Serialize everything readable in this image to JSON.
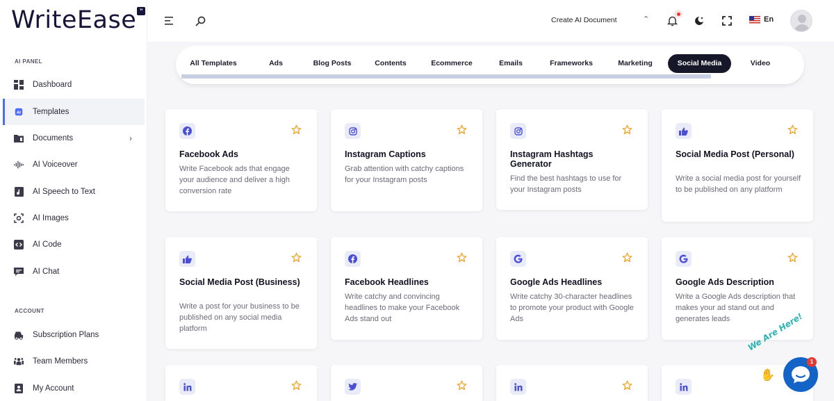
{
  "app": {
    "logo": "WriteEase",
    "logo_mark": "”"
  },
  "sidebar": {
    "ai_panel_label": "AI PANEL",
    "account_label": "ACCOUNT",
    "items": [
      {
        "label": "Dashboard",
        "icon": "dashboard-icon"
      },
      {
        "label": "Templates",
        "icon": "ai-chip-icon",
        "active": true
      },
      {
        "label": "Documents",
        "icon": "folder-icon",
        "has_submenu": true
      },
      {
        "label": "AI Voiceover",
        "icon": "waveform-icon"
      },
      {
        "label": "AI Speech to Text",
        "icon": "audio-file-icon"
      },
      {
        "label": "AI Images",
        "icon": "image-scan-icon"
      },
      {
        "label": "AI Code",
        "icon": "code-icon"
      },
      {
        "label": "AI Chat",
        "icon": "chat-icon"
      }
    ],
    "account_items": [
      {
        "label": "Subscription Plans",
        "icon": "car-icon"
      },
      {
        "label": "Team Members",
        "icon": "team-icon"
      },
      {
        "label": "My Account",
        "icon": "user-badge-icon"
      }
    ]
  },
  "header": {
    "create_document": "Create AI Document",
    "language": "En"
  },
  "tabs": [
    {
      "label": "All Templates"
    },
    {
      "label": "Ads"
    },
    {
      "label": "Blog Posts"
    },
    {
      "label": "Contents"
    },
    {
      "label": "Ecommerce"
    },
    {
      "label": "Emails"
    },
    {
      "label": "Frameworks"
    },
    {
      "label": "Marketing"
    },
    {
      "label": "Social Media",
      "active": true
    },
    {
      "label": "Video"
    }
  ],
  "cards": [
    {
      "title": "Facebook Ads",
      "desc": "Write Facebook ads that engage your audience and deliver a high conversion rate",
      "icon": "facebook-icon"
    },
    {
      "title": "Instagram Captions",
      "desc": "Grab attention with catchy captions for your Instagram posts",
      "icon": "instagram-icon"
    },
    {
      "title": "Instagram Hashtags Generator",
      "desc": "Find the best hashtags to use for your Instagram posts",
      "icon": "instagram-icon"
    },
    {
      "title": "Social Media Post (Personal)",
      "desc": "Write a social media post for yourself to be published on any platform",
      "icon": "thumbs-up-icon"
    },
    {
      "title": "Social Media Post (Business)",
      "desc": "Write a post for your business to be published on any social media platform",
      "icon": "thumbs-up-icon"
    },
    {
      "title": "Facebook Headlines",
      "desc": "Write catchy and convincing headlines to make your Facebook Ads stand out",
      "icon": "facebook-icon"
    },
    {
      "title": "Google Ads Headlines",
      "desc": "Write catchy 30-character headlines to promote your product with Google Ads",
      "icon": "google-icon"
    },
    {
      "title": "Google Ads Description",
      "desc": "Write a Google Ads description that makes your ad stand out and generates leads",
      "icon": "google-icon"
    },
    {
      "title": "",
      "desc": "",
      "icon": "linkedin-icon"
    },
    {
      "title": "",
      "desc": "",
      "icon": "twitter-icon"
    },
    {
      "title": "",
      "desc": "",
      "icon": "linkedin-icon"
    },
    {
      "title": "",
      "desc": "",
      "icon": "linkedin-icon"
    }
  ],
  "chat_widget": {
    "tagline": "We Are Here!",
    "badge_count": "1"
  },
  "colors": {
    "accent": "#4b6bfb",
    "icon_tint": "#4b4fd8",
    "star": "#f0a020",
    "active_tab": "#17172a",
    "chat": "#1463c7"
  }
}
